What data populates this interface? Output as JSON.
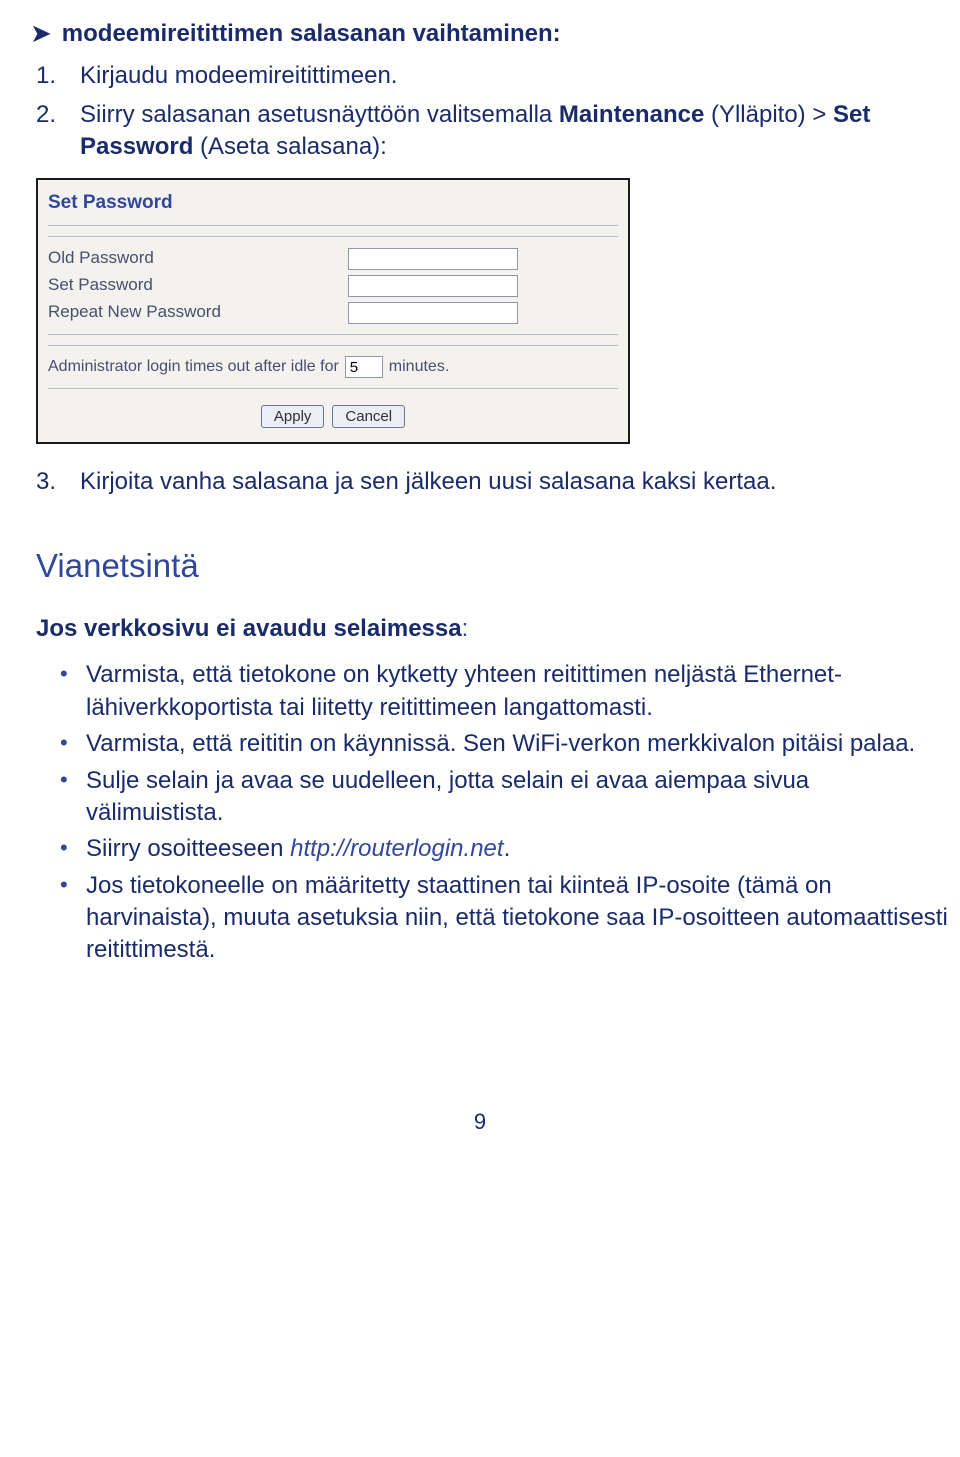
{
  "heading": {
    "arrow_glyph": "➤",
    "title": "modeemireitittimen salasanan vaihtaminen:"
  },
  "ordered": [
    {
      "num": "1.",
      "text": "Kirjaudu modeemireitittimeen."
    },
    {
      "num": "2.",
      "text_before": "Siirry salasanan asetusnäyttöön valitsemalla ",
      "bold1": "Maintenance",
      "mid": " (Ylläpito) > ",
      "bold2": "Set Password",
      "after": " (Aseta salasana):"
    },
    {
      "num": "3.",
      "text": "Kirjoita vanha salasana ja sen jälkeen uusi salasana kaksi kertaa."
    }
  ],
  "screenshot": {
    "title": "Set Password",
    "rows": {
      "old": "Old Password",
      "set": "Set Password",
      "repeat": "Repeat New Password"
    },
    "timeout_before": "Administrator login times out after idle for",
    "timeout_value": "5",
    "timeout_after": "minutes.",
    "apply": "Apply",
    "cancel": "Cancel"
  },
  "section_title": "Vianetsintä",
  "sub_statement": {
    "text": "Jos verkkosivu ei avaudu selaimessa",
    "colon": ":"
  },
  "bullets": [
    {
      "text": "Varmista, että tietokone on kytketty yhteen reitittimen neljästä Ethernet-lähiverkkoportista tai liitetty reitittimeen langattomasti."
    },
    {
      "text": "Varmista, että reititin on käynnissä. Sen WiFi-verkon merkkivalon pitäisi palaa."
    },
    {
      "text": "Sulje selain ja avaa se uudelleen, jotta selain ei avaa aiempaa sivua välimuistista."
    },
    {
      "text_before": "Siirry osoitteeseen ",
      "link": "http://routerlogin.net",
      "text_after": "."
    },
    {
      "text": "Jos tietokoneelle on määritetty staattinen tai kiinteä IP-osoite (tämä on harvinaista), muuta asetuksia niin, että tietokone saa IP-osoitteen automaattisesti reitittimestä."
    }
  ],
  "page_number": "9"
}
